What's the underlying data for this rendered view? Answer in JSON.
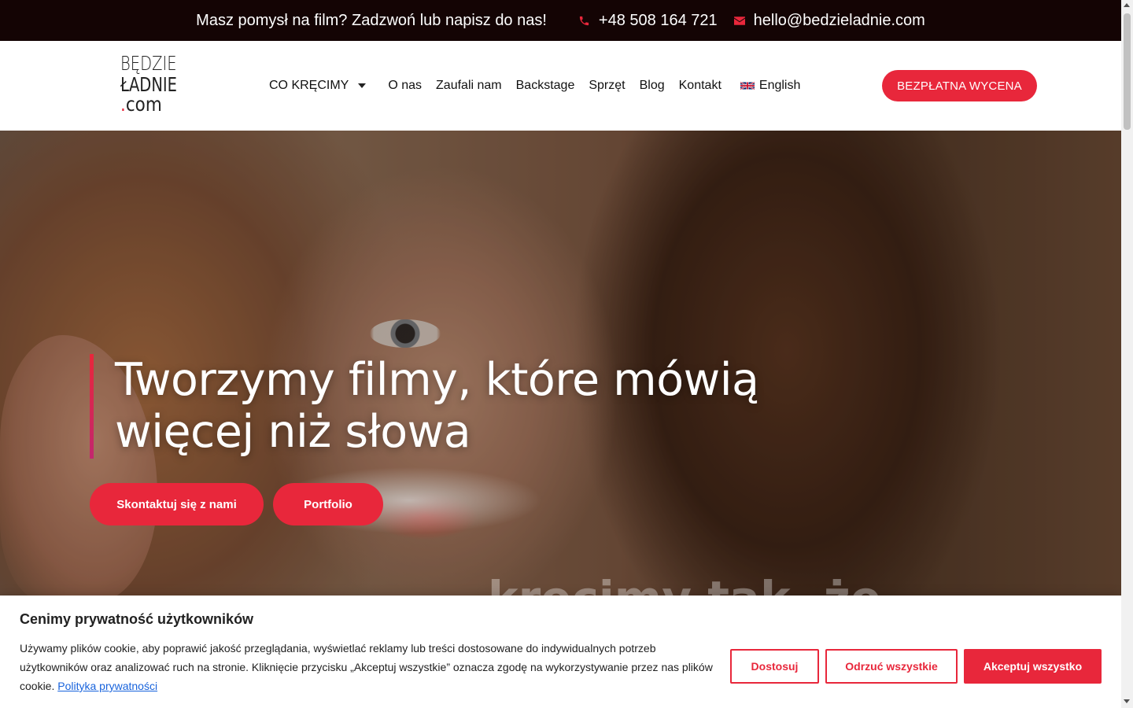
{
  "topbar": {
    "text": "Masz pomysł na film? Zadzwoń lub napisz do nas!",
    "phone": "+48 508 164 721",
    "email": "hello@bedzieladnie.com",
    "phone_icon": "phone-icon",
    "email_icon": "envelope-icon"
  },
  "logo": {
    "line1": "BĘDZIE",
    "line2": "ŁADNIE",
    "line3_dot": ".",
    "line3": "com"
  },
  "nav": {
    "items": [
      {
        "label": "CO KRĘCIMY",
        "dropdown": true
      },
      {
        "label": "O nas"
      },
      {
        "label": "Zaufali nam"
      },
      {
        "label": "Backstage"
      },
      {
        "label": "Sprzęt"
      },
      {
        "label": "Blog"
      },
      {
        "label": "Kontakt"
      },
      {
        "label": "English",
        "icon": "uk-flag-icon"
      }
    ]
  },
  "header_cta": "BEZPŁATNA WYCENA",
  "hero": {
    "title": "Tworzymy filmy, które mówią więcej niż słowa",
    "button_contact": "Skontaktuj się z nami",
    "button_portfolio": "Portfolio",
    "overlay_text": "kręcimy tak, że"
  },
  "cookie": {
    "title": "Cenimy prywatność użytkowników",
    "text": "Używamy plików cookie, aby poprawić jakość przeglądania, wyświetlać reklamy lub treści dostosowane do indywidualnych potrzeb użytkowników oraz analizować ruch na stronie. Kliknięcie przycisku „Akceptuj wszystkie” oznacza zgodę na wykorzystywanie przez nas plików cookie.",
    "policy_link": "Polityka prywatności",
    "btn_customize": "Dostosuj",
    "btn_reject": "Odrzuć wszystkie",
    "btn_accept": "Akceptuj wszystko"
  },
  "colors": {
    "accent": "#e8273b",
    "topbar_bg": "#140404",
    "link": "#1863dc"
  }
}
